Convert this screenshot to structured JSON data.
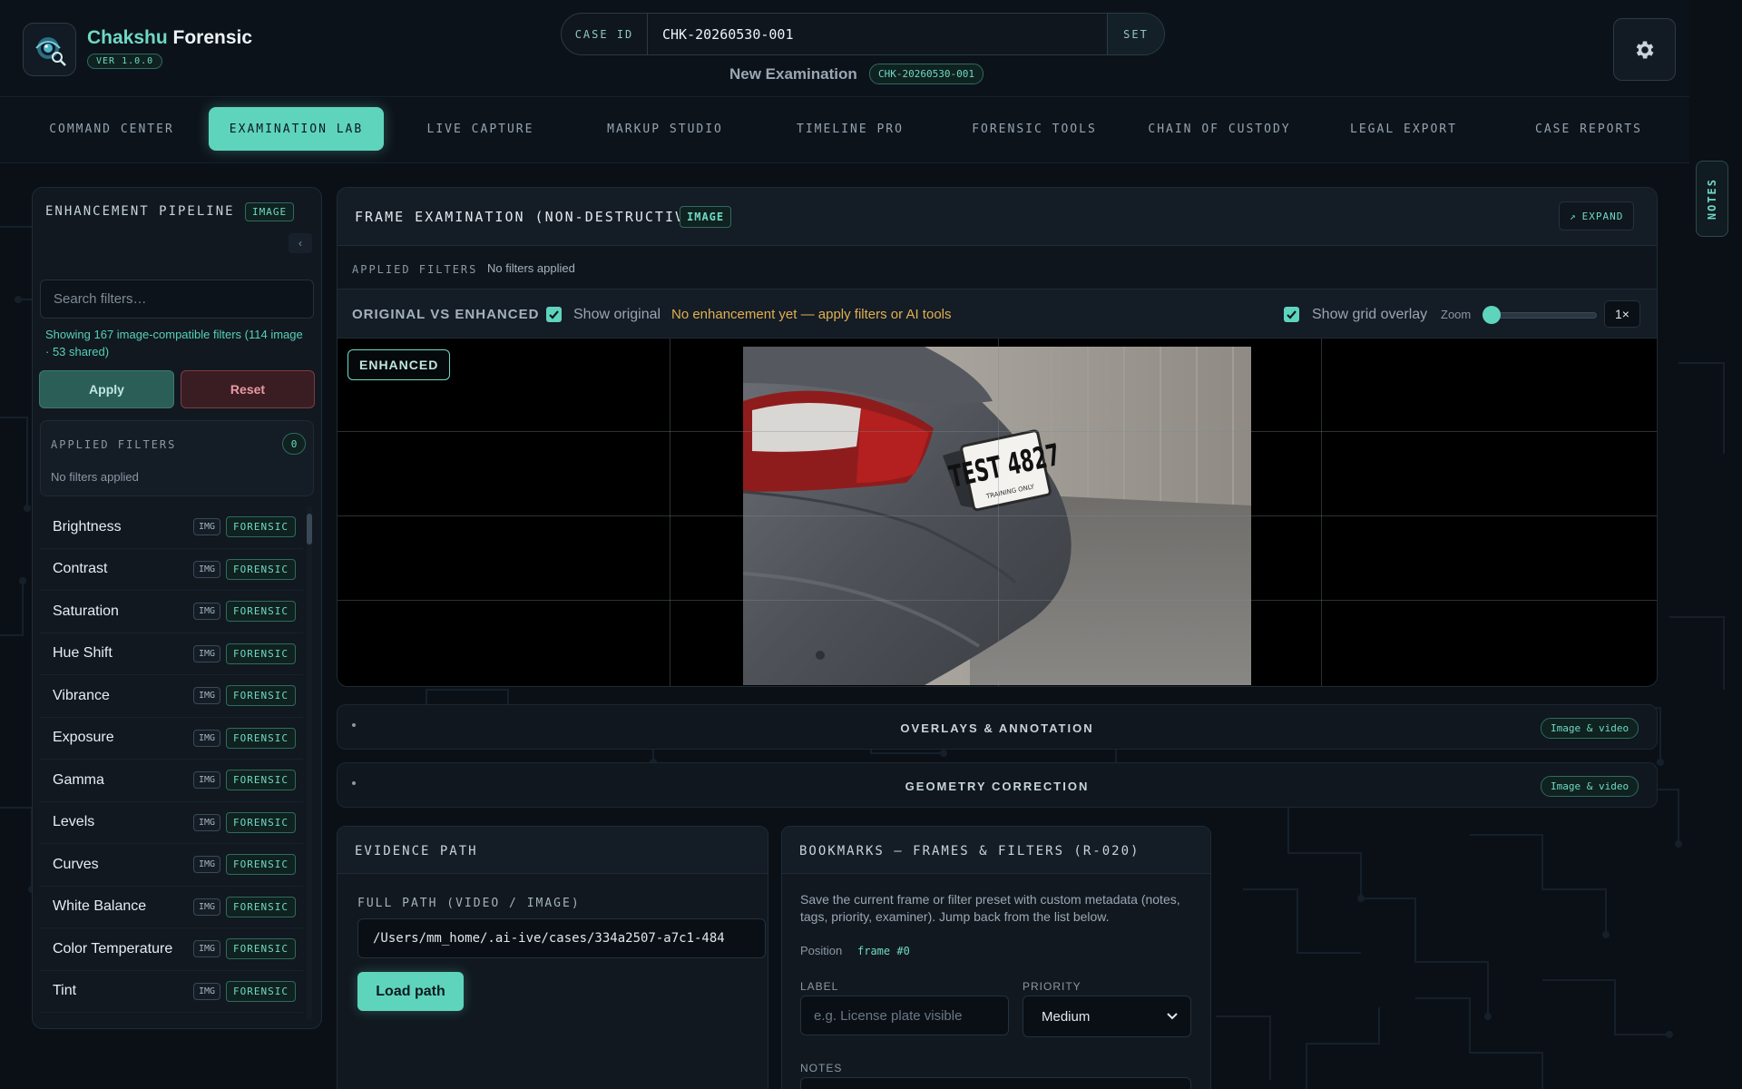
{
  "app": {
    "title_accent": "Chakshu",
    "title_rest": " Forensic",
    "version": "VER 1.0.0",
    "logo_icon": "eye-magnifier-icon",
    "settings_icon": "gear-icon"
  },
  "case": {
    "label": "CASE ID",
    "value": "CHK-20260530-001",
    "set_label": "SET",
    "exam_title": "New Examination",
    "exam_badge": "CHK-20260530-001"
  },
  "nav": {
    "tabs": [
      {
        "label": "COMMAND CENTER",
        "active": false
      },
      {
        "label": "EXAMINATION LAB",
        "active": true
      },
      {
        "label": "LIVE CAPTURE",
        "active": false
      },
      {
        "label": "MARKUP STUDIO",
        "active": false
      },
      {
        "label": "TIMELINE PRO",
        "active": false
      },
      {
        "label": "FORENSIC TOOLS",
        "active": false
      },
      {
        "label": "CHAIN OF CUSTODY",
        "active": false
      },
      {
        "label": "LEGAL EXPORT",
        "active": false
      },
      {
        "label": "CASE REPORTS",
        "active": false
      }
    ]
  },
  "notes_tab": "NOTES",
  "sidebar": {
    "title": "ENHANCEMENT PIPELINE",
    "badge": "IMAGE",
    "collapse_icon": "chevron-left-icon",
    "search_placeholder": "Search filters…",
    "count_text": "Showing 167 image-compatible filters (114 image · 53 shared)",
    "apply_label": "Apply",
    "reset_label": "Reset",
    "applied_title": "APPLIED FILTERS",
    "applied_count": "0",
    "applied_none": "No filters applied",
    "filters": [
      {
        "name": "Brightness",
        "type": "IMG",
        "tag": "FORENSIC"
      },
      {
        "name": "Contrast",
        "type": "IMG",
        "tag": "FORENSIC"
      },
      {
        "name": "Saturation",
        "type": "IMG",
        "tag": "FORENSIC"
      },
      {
        "name": "Hue Shift",
        "type": "IMG",
        "tag": "FORENSIC"
      },
      {
        "name": "Vibrance",
        "type": "IMG",
        "tag": "FORENSIC"
      },
      {
        "name": "Exposure",
        "type": "IMG",
        "tag": "FORENSIC"
      },
      {
        "name": "Gamma",
        "type": "IMG",
        "tag": "FORENSIC"
      },
      {
        "name": "Levels",
        "type": "IMG",
        "tag": "FORENSIC"
      },
      {
        "name": "Curves",
        "type": "IMG",
        "tag": "FORENSIC"
      },
      {
        "name": "White Balance",
        "type": "IMG",
        "tag": "FORENSIC"
      },
      {
        "name": "Color Temperature",
        "type": "IMG",
        "tag": "FORENSIC"
      },
      {
        "name": "Tint",
        "type": "IMG",
        "tag": "FORENSIC"
      }
    ]
  },
  "examination": {
    "title": "FRAME EXAMINATION (NON-DESTRUCTIVE)",
    "badge": "IMAGE",
    "expand_label": "EXPAND",
    "expand_icon": "arrow-up-right-icon",
    "applied_label": "APPLIED FILTERS",
    "applied_value": "No filters applied",
    "compare_label": "ORIGINAL VS ENHANCED",
    "show_original_label": "Show original",
    "show_original_checked": true,
    "warning": "No enhancement yet — apply filters or AI tools",
    "show_grid_label": "Show grid overlay",
    "show_grid_checked": true,
    "zoom_label": "Zoom",
    "zoom_value": "1×",
    "viewer_badge": "ENHANCED",
    "plate_text": "TEST 4827",
    "plate_subtext": "TRAINING ONLY"
  },
  "sections": [
    {
      "title": "OVERLAYS & ANNOTATION",
      "badge": "Image & video"
    },
    {
      "title": "GEOMETRY CORRECTION",
      "badge": "Image & video"
    }
  ],
  "evidence": {
    "title": "EVIDENCE PATH",
    "field_label": "FULL PATH (VIDEO / IMAGE)",
    "path_value": "/Users/mm_home/.ai-ive/cases/334a2507-a7c1-484",
    "load_label": "Load path"
  },
  "bookmarks": {
    "title": "BOOKMARKS — FRAMES & FILTERS (R-020)",
    "description": "Save the current frame or filter preset with custom metadata (notes, tags, priority, examiner). Jump back from the list below.",
    "position_label": "Position",
    "position_value": "frame #0",
    "label_label": "LABEL",
    "label_placeholder": "e.g. License plate visible",
    "priority_label": "PRIORITY",
    "priority_value": "Medium",
    "notes_label": "NOTES"
  },
  "colors": {
    "accent": "#5fd4bd",
    "background": "#0b1017",
    "panel": "#111820",
    "warning": "#e0b04f",
    "danger": "#e79aa4"
  }
}
